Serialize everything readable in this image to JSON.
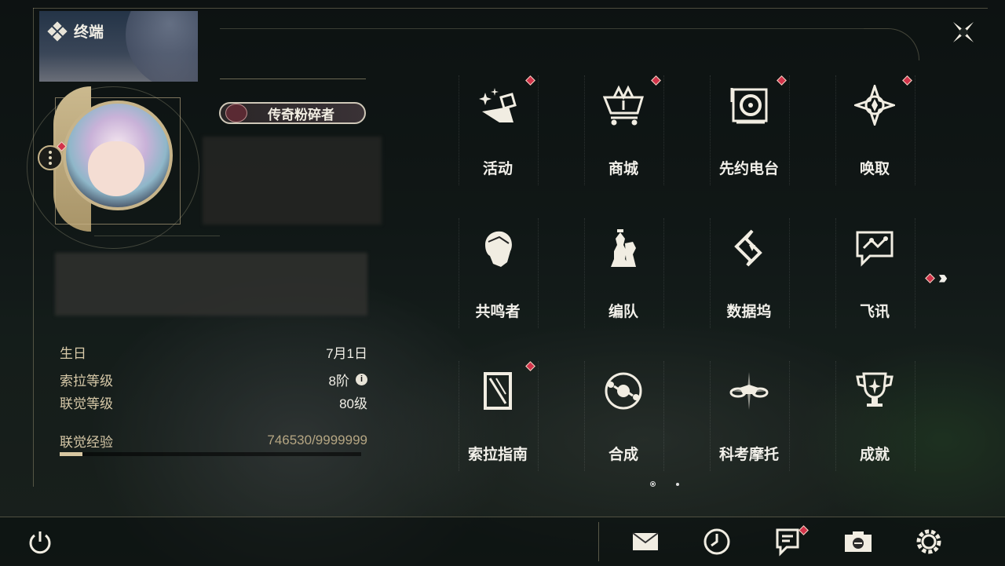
{
  "header": {
    "title": "终端",
    "player_title": "传奇粉碎者"
  },
  "stats": {
    "birthday": {
      "label": "生日",
      "value": "7月1日"
    },
    "sola_level": {
      "label": "索拉等级",
      "value": "8阶"
    },
    "union_level": {
      "label": "联觉等级",
      "value": "80级"
    },
    "union_exp": {
      "label": "联觉经验",
      "value": "746530/9999999",
      "progress": 0.0747
    }
  },
  "menu": [
    {
      "label": "活动",
      "icon": "sparkle-icon",
      "badge": true
    },
    {
      "label": "商城",
      "icon": "cart-icon",
      "badge": true
    },
    {
      "label": "先约电台",
      "icon": "radio-icon",
      "badge": true
    },
    {
      "label": "唤取",
      "icon": "compass-star-icon",
      "badge": true
    },
    {
      "label": "共鸣者",
      "icon": "resonator-head-icon",
      "badge": false
    },
    {
      "label": "编队",
      "icon": "chess-pieces-icon",
      "badge": false
    },
    {
      "label": "数据坞",
      "icon": "data-dock-icon",
      "badge": false
    },
    {
      "label": "飞讯",
      "icon": "chat-icon",
      "badge": false
    },
    {
      "label": "索拉指南",
      "icon": "guide-book-icon",
      "badge": true
    },
    {
      "label": "合成",
      "icon": "synthesis-icon",
      "badge": false
    },
    {
      "label": "科考摩托",
      "icon": "motorbike-icon",
      "badge": false
    },
    {
      "label": "成就",
      "icon": "trophy-icon",
      "badge": false
    }
  ],
  "bottom_bar": [
    "mail-icon",
    "clock-icon",
    "notice-icon",
    "camera-icon",
    "settings-icon"
  ],
  "colors": {
    "accent_gold": "#c7b48a",
    "badge_red": "#d2334a",
    "text_light": "#f2f0ea"
  }
}
